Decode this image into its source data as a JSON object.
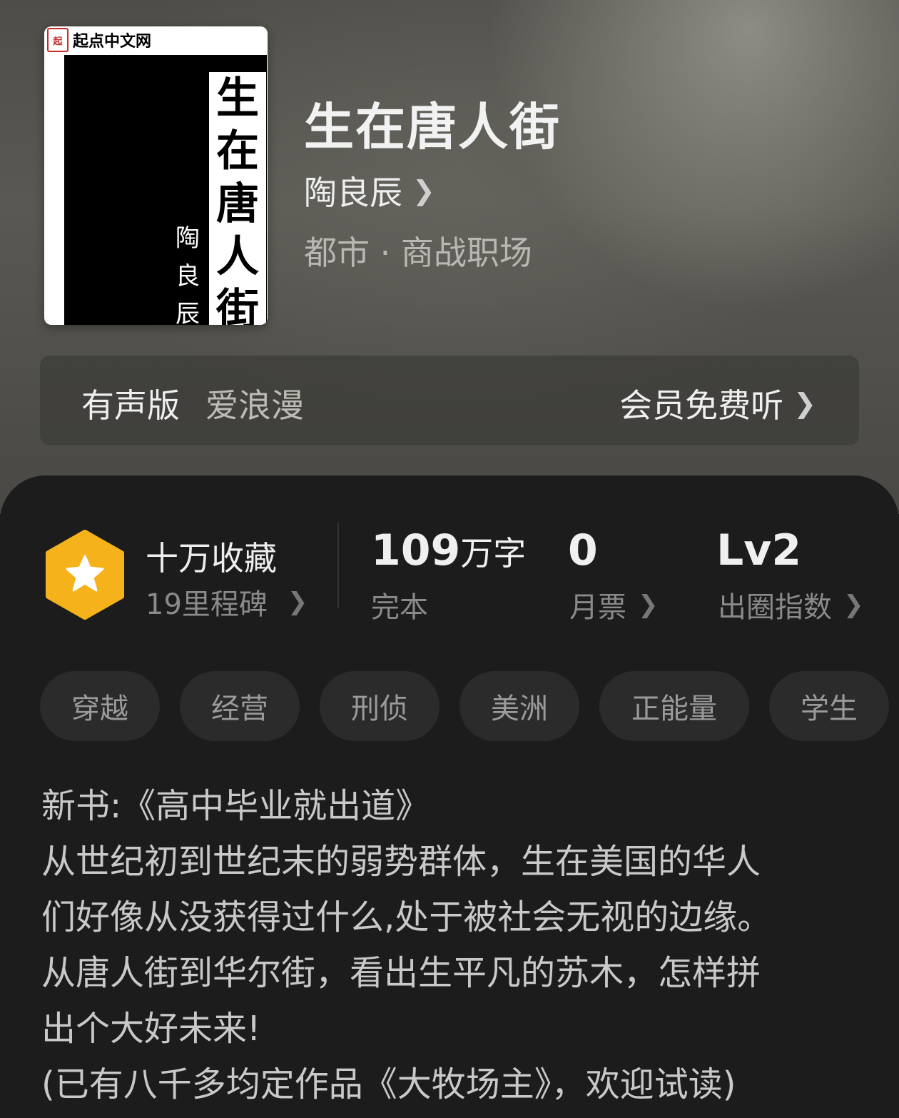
{
  "book": {
    "title": "生在唐人街",
    "author": "陶良辰",
    "category": "都市 · 商战职场"
  },
  "cover": {
    "publisher_logo": "起点中文网",
    "seal_text": "起",
    "title_chars": [
      "生",
      "在",
      "唐",
      "人",
      "街"
    ],
    "author_chars": [
      "陶",
      "良",
      "辰"
    ]
  },
  "audio": {
    "label": "有声版",
    "narrator": "爱浪漫",
    "cta": "会员免费听"
  },
  "stats": {
    "collection": "十万收藏",
    "milestone": "19里程碑",
    "word_count_number": "109",
    "word_count_unit": "万字",
    "status": "完本",
    "monthly_votes": "0",
    "monthly_votes_label": "月票",
    "level": "Lv2",
    "level_label": "出圈指数"
  },
  "tags": [
    "穿越",
    "经营",
    "刑侦",
    "美洲",
    "正能量",
    "学生"
  ],
  "description": [
    "新书:《高中毕业就出道》",
    "从世纪初到世纪末的弱势群体，生在美国的华人",
    "们好像从没获得过什么,处于被社会无视的边缘。",
    "从唐人街到华尔街，看出生平凡的苏木，怎样拼",
    "出个大好未来!",
    "(已有八千多均定作品《大牧场主》，欢迎试读)"
  ],
  "colors": {
    "badge_fill": "#f6b21b",
    "panel_bg": "#1c1c1c",
    "tag_bg": "#2b2b2b"
  }
}
